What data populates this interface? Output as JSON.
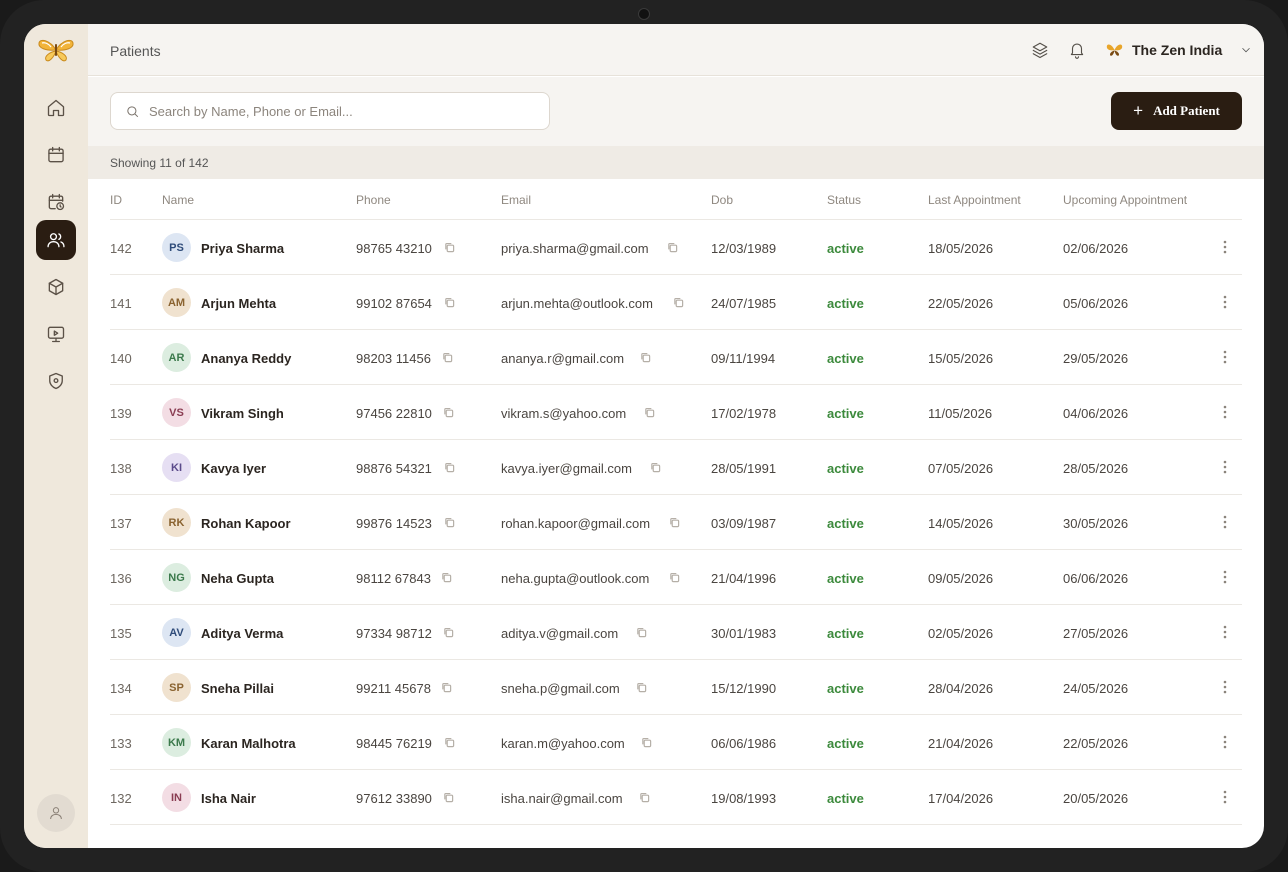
{
  "header": {
    "breadcrumb": "Patients",
    "org_name": "The Zen India"
  },
  "toolbar": {
    "search_placeholder": "Search by Name, Phone or Email...",
    "add_button_label": "Add Patient",
    "add_button_icon": "plus-icon"
  },
  "count_text": "Showing 11 of 142",
  "sidebar": {
    "items": [
      {
        "icon": "home-icon"
      },
      {
        "icon": "calendar-icon"
      },
      {
        "icon": "calendar-clock-icon"
      },
      {
        "icon": "users-icon",
        "active": true
      },
      {
        "icon": "box-icon"
      },
      {
        "icon": "monitor-play-icon"
      },
      {
        "icon": "shield-icon"
      }
    ]
  },
  "colors": {
    "accent": "#2a1d12",
    "sidebar_bg": "#efe8dc",
    "status_active": "#3c8a3c"
  },
  "table": {
    "columns": [
      "ID",
      "Name",
      "Phone",
      "Email",
      "Dob",
      "Status",
      "Last Appointment",
      "Upcoming Appointment"
    ],
    "rows": [
      {
        "id": "142",
        "initials": "PS",
        "name": "Priya Sharma",
        "phone": "98765 43210",
        "email": "priya.sharma@gmail.com",
        "dob": "12/03/1989",
        "status": "active",
        "last": "18/05/2026",
        "upcoming": "02/06/2026",
        "avatar_bg": "#dde6f3",
        "avatar_fg": "#2f4c7a"
      },
      {
        "id": "141",
        "initials": "AM",
        "name": "Arjun Mehta",
        "phone": "99102 87654",
        "email": "arjun.mehta@outlook.com",
        "dob": "24/07/1985",
        "status": "active",
        "last": "22/05/2026",
        "upcoming": "05/06/2026",
        "avatar_bg": "#f0e2cf",
        "avatar_fg": "#8a6330"
      },
      {
        "id": "140",
        "initials": "AR",
        "name": "Ananya Reddy",
        "phone": "98203 11456",
        "email": "ananya.r@gmail.com",
        "dob": "09/11/1994",
        "status": "active",
        "last": "15/05/2026",
        "upcoming": "29/05/2026",
        "avatar_bg": "#dcede0",
        "avatar_fg": "#3c7a4c"
      },
      {
        "id": "139",
        "initials": "VS",
        "name": "Vikram Singh",
        "phone": "97456 22810",
        "email": "vikram.s@yahoo.com",
        "dob": "17/02/1978",
        "status": "active",
        "last": "11/05/2026",
        "upcoming": "04/06/2026",
        "avatar_bg": "#f3dde4",
        "avatar_fg": "#8a3c52"
      },
      {
        "id": "138",
        "initials": "KI",
        "name": "Kavya Iyer",
        "phone": "98876 54321",
        "email": "kavya.iyer@gmail.com",
        "dob": "28/05/1991",
        "status": "active",
        "last": "07/05/2026",
        "upcoming": "28/05/2026",
        "avatar_bg": "#e6dff3",
        "avatar_fg": "#5a4a8a"
      },
      {
        "id": "137",
        "initials": "RK",
        "name": "Rohan Kapoor",
        "phone": "99876 14523",
        "email": "rohan.kapoor@gmail.com",
        "dob": "03/09/1987",
        "status": "active",
        "last": "14/05/2026",
        "upcoming": "30/05/2026",
        "avatar_bg": "#f0e2cf",
        "avatar_fg": "#8a6330"
      },
      {
        "id": "136",
        "initials": "NG",
        "name": "Neha Gupta",
        "phone": "98112 67843",
        "email": "neha.gupta@outlook.com",
        "dob": "21/04/1996",
        "status": "active",
        "last": "09/05/2026",
        "upcoming": "06/06/2026",
        "avatar_bg": "#dcede0",
        "avatar_fg": "#3c7a4c"
      },
      {
        "id": "135",
        "initials": "AV",
        "name": "Aditya Verma",
        "phone": "97334 98712",
        "email": "aditya.v@gmail.com",
        "dob": "30/01/1983",
        "status": "active",
        "last": "02/05/2026",
        "upcoming": "27/05/2026",
        "avatar_bg": "#dde6f3",
        "avatar_fg": "#2f4c7a"
      },
      {
        "id": "134",
        "initials": "SP",
        "name": "Sneha Pillai",
        "phone": "99211 45678",
        "email": "sneha.p@gmail.com",
        "dob": "15/12/1990",
        "status": "active",
        "last": "28/04/2026",
        "upcoming": "24/05/2026",
        "avatar_bg": "#f0e2cf",
        "avatar_fg": "#8a6330"
      },
      {
        "id": "133",
        "initials": "KM",
        "name": "Karan Malhotra",
        "phone": "98445 76219",
        "email": "karan.m@yahoo.com",
        "dob": "06/06/1986",
        "status": "active",
        "last": "21/04/2026",
        "upcoming": "22/05/2026",
        "avatar_bg": "#dcede0",
        "avatar_fg": "#3c7a4c"
      },
      {
        "id": "132",
        "initials": "IN",
        "name": "Isha Nair",
        "phone": "97612 33890",
        "email": "isha.nair@gmail.com",
        "dob": "19/08/1993",
        "status": "active",
        "last": "17/04/2026",
        "upcoming": "20/05/2026",
        "avatar_bg": "#f3dde4",
        "avatar_fg": "#8a3c52"
      }
    ]
  }
}
